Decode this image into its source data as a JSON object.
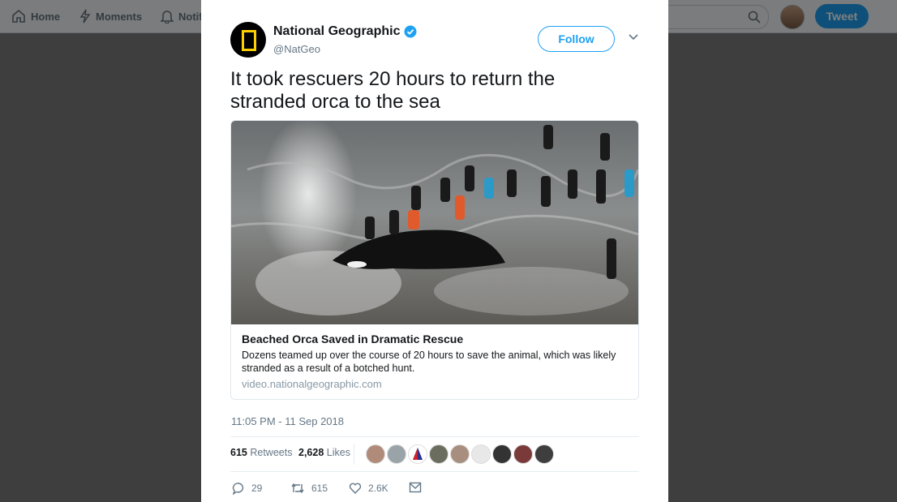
{
  "nav": {
    "home_label": "Home",
    "moments_label": "Moments",
    "notifications_label": "Notif",
    "tweet_button_label": "Tweet"
  },
  "tweet": {
    "author_name": "National Geographic",
    "author_handle": "@NatGeo",
    "verified": true,
    "follow_label": "Follow",
    "text": "It took rescuers 20 hours to return the stranded orca to the sea",
    "card": {
      "title": "Beached Orca Saved in Dramatic Rescue",
      "description": "Dozens teamed up over the course of 20 hours to save the animal, which was likely stranded as a result of a botched hunt.",
      "domain": "video.nationalgeographic.com"
    },
    "timestamp": "11:05 PM - 11 Sep 2018",
    "retweets_count": "615",
    "retweets_label": "Retweets",
    "likes_count": "2,628",
    "likes_label": "Likes",
    "actions": {
      "replies": "29",
      "retweets": "615",
      "likes": "2.6K"
    }
  },
  "colors": {
    "accent": "#1da1f2",
    "natgeo_yellow": "#ffce00",
    "text": "#14171a",
    "muted": "#657786"
  },
  "icons": [
    "home-icon",
    "moments-icon",
    "bell-icon",
    "search-icon",
    "verified-icon",
    "chevron-down-icon",
    "reply-icon",
    "retweet-icon",
    "heart-icon",
    "message-icon"
  ]
}
